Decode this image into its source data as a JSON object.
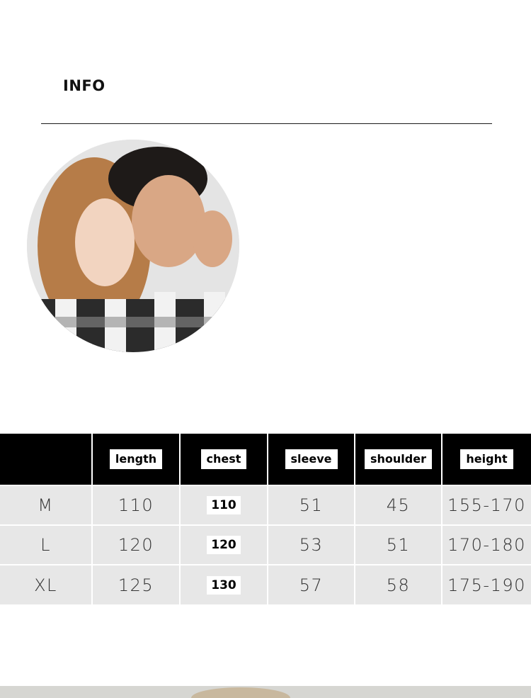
{
  "header": {
    "title": "INFO"
  },
  "photo": {
    "description_icon": "couple-photo"
  },
  "size_table": {
    "columns": [
      "",
      "length",
      "chest",
      "sleeve",
      "shoulder",
      "height"
    ],
    "rows": [
      {
        "size": "M",
        "length": "110",
        "chest": "110",
        "sleeve": "51",
        "shoulder": "45",
        "height": "155-170"
      },
      {
        "size": "L",
        "length": "120",
        "chest": "120",
        "sleeve": "53",
        "shoulder": "51",
        "height": "170-180"
      },
      {
        "size": "XL",
        "length": "125",
        "chest": "130",
        "sleeve": "57",
        "shoulder": "58",
        "height": "175-190"
      }
    ]
  },
  "colors": {
    "header_bg": "#000000",
    "row_bg": "#e7e7e7",
    "divider": "#1a1a1a"
  }
}
